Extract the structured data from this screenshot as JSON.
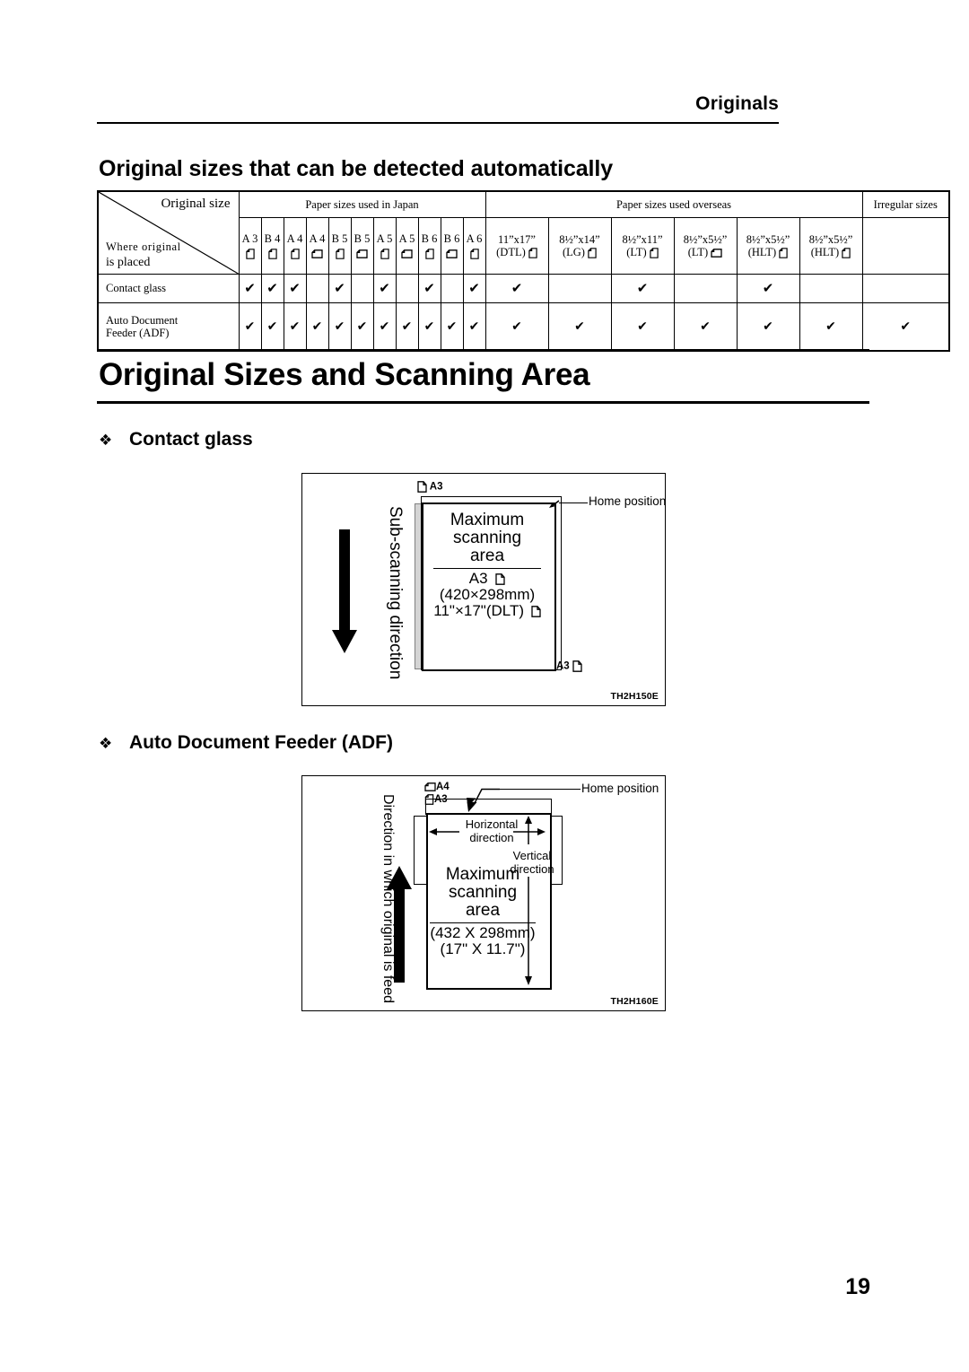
{
  "header": {
    "running_head": "Originals"
  },
  "subsection": {
    "title": "Original sizes that can be detected automatically"
  },
  "table": {
    "corner": {
      "top_label": "Original size",
      "bottom_line1": "Where original",
      "bottom_line2": "is placed"
    },
    "group_headers": [
      {
        "label": "Paper sizes used in Japan",
        "span": 11
      },
      {
        "label": "Paper sizes used overseas",
        "span": 6
      },
      {
        "label": "Irregular sizes",
        "span": 1
      }
    ],
    "columns_japan": [
      {
        "label": "A 3",
        "orientation": "portrait"
      },
      {
        "label": "B 4",
        "orientation": "portrait"
      },
      {
        "label": "A 4",
        "orientation": "portrait"
      },
      {
        "label": "A 4",
        "orientation": "landscape"
      },
      {
        "label": "B 5",
        "orientation": "portrait"
      },
      {
        "label": "B 5",
        "orientation": "landscape"
      },
      {
        "label": "A 5",
        "orientation": "portrait"
      },
      {
        "label": "A 5",
        "orientation": "landscape"
      },
      {
        "label": "B 6",
        "orientation": "portrait"
      },
      {
        "label": "B 6",
        "orientation": "landscape"
      },
      {
        "label": "A 6",
        "orientation": "portrait"
      }
    ],
    "columns_overseas": [
      {
        "line1": "11”x17”",
        "line2": "(DTL)",
        "orientation": "portrait"
      },
      {
        "line1": "8½”x14”",
        "line2": "(LG)",
        "orientation": "portrait"
      },
      {
        "line1": "8½”x11”",
        "line2": "(LT)",
        "orientation": "portrait"
      },
      {
        "line1": "8½”x5½”",
        "line2": "(LT)",
        "orientation": "landscape"
      },
      {
        "line1": "8½”x5½”",
        "line2": "(HLT)",
        "orientation": "portrait"
      },
      {
        "line1": "8½”x5½”",
        "line2": "(HLT)",
        "orientation": "portrait"
      }
    ],
    "columns_irregular": [
      {
        "label": "",
        "orientation": "none"
      }
    ],
    "check_glyph": "✔",
    "rows": [
      {
        "label_line1": "Contact glass",
        "label_line2": "",
        "japan": [
          true,
          true,
          true,
          false,
          true,
          false,
          true,
          false,
          true,
          false,
          true
        ],
        "overseas": [
          true,
          false,
          true,
          false,
          true,
          false
        ],
        "irregular": [
          false
        ]
      },
      {
        "label_line1": "Auto Document",
        "label_line2": "Feeder (ADF)",
        "japan": [
          true,
          true,
          true,
          true,
          true,
          true,
          true,
          true,
          true,
          true,
          true
        ],
        "overseas": [
          true,
          true,
          true,
          true,
          true,
          true
        ],
        "irregular": [
          true
        ]
      }
    ]
  },
  "main_heading": {
    "title": "Original Sizes and Scanning Area"
  },
  "sections": [
    {
      "bullet": "❖",
      "title": "Contact glass"
    },
    {
      "bullet": "❖",
      "title": "Auto Document Feeder (ADF)"
    }
  ],
  "figure_contact": {
    "figure_id": "TH2H150E",
    "vertical_label": "Sub-scanning direction",
    "top_marker": "A3",
    "bottom_marker": "A3",
    "home_position": "Home position",
    "max_line1": "Maximum",
    "max_line2": "scanning",
    "max_line3": "area",
    "size_line1": "A3",
    "size_line2": "(420×298mm)",
    "size_line3": "11\"×17\"(DLT)"
  },
  "figure_adf": {
    "figure_id": "TH2H160E",
    "vertical_label": "Direction in which original is feed",
    "marker_a4": "A4",
    "marker_a3": "A3",
    "home_position": "Home position",
    "horizontal_line1": "Horizontal",
    "horizontal_line2": "direction",
    "vertical_line1": "Vertical",
    "vertical_line2": "direction",
    "max_line1": "Maximum",
    "max_line2": "scanning",
    "max_line3": "area",
    "size_line1": "(432 X 298mm)",
    "size_line2": "(17\" X 11.7\")"
  },
  "footer": {
    "page_number": "19"
  }
}
